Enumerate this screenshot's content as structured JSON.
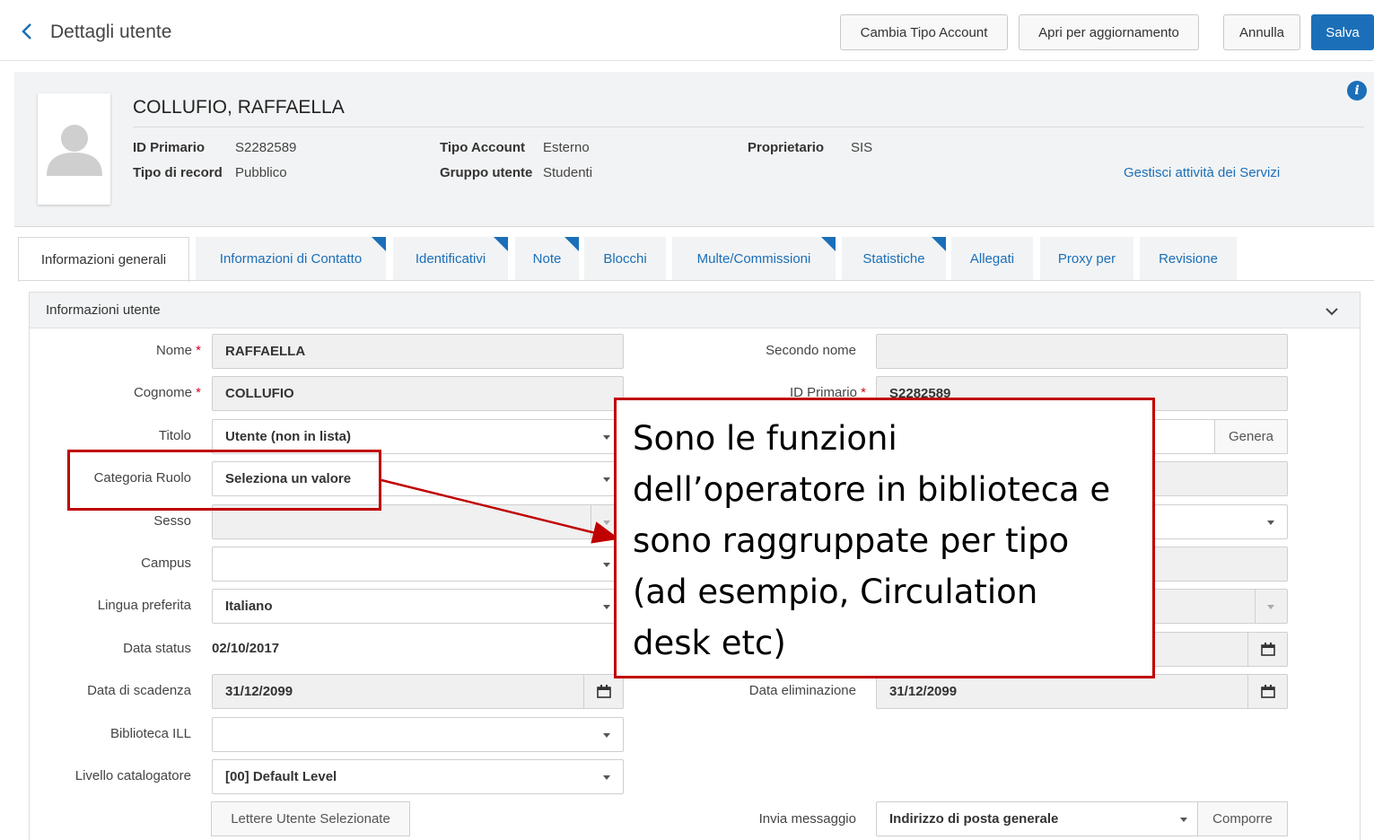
{
  "header": {
    "title": "Dettagli utente",
    "buttons": {
      "change_account_type": "Cambia Tipo Account",
      "open_for_update": "Apri per aggiornamento",
      "cancel": "Annulla",
      "save": "Salva"
    }
  },
  "user": {
    "name": "COLLUFIO, RAFFAELLA",
    "primary_id_label": "ID Primario",
    "primary_id": "S2282589",
    "record_type_label": "Tipo di record",
    "record_type": "Pubblico",
    "account_type_label": "Tipo Account",
    "account_type": "Esterno",
    "user_group_label": "Gruppo utente",
    "user_group": "Studenti",
    "owner_label": "Proprietario",
    "owner": "SIS",
    "manage_services_link": "Gestisci attività dei Servizi"
  },
  "tabs": [
    {
      "label": "Informazioni generali",
      "active": true,
      "marked": false
    },
    {
      "label": "Informazioni di Contatto",
      "active": false,
      "marked": true
    },
    {
      "label": "Identificativi",
      "active": false,
      "marked": true
    },
    {
      "label": "Note",
      "active": false,
      "marked": true
    },
    {
      "label": "Blocchi",
      "active": false,
      "marked": false
    },
    {
      "label": "Multe/Commissioni",
      "active": false,
      "marked": true
    },
    {
      "label": "Statistiche",
      "active": false,
      "marked": true
    },
    {
      "label": "Allegati",
      "active": false,
      "marked": false
    },
    {
      "label": "Proxy per",
      "active": false,
      "marked": false
    },
    {
      "label": "Revisione",
      "active": false,
      "marked": false
    }
  ],
  "section": {
    "title": "Informazioni utente",
    "required_mark": "*",
    "left": {
      "first_name": {
        "label": "Nome",
        "value": "RAFFAELLA"
      },
      "last_name": {
        "label": "Cognome",
        "value": "COLLUFIO"
      },
      "title": {
        "label": "Titolo",
        "value": "Utente (non in lista)"
      },
      "role_category": {
        "label": "Categoria Ruolo",
        "value": "Seleziona un valore"
      },
      "gender": {
        "label": "Sesso",
        "value": ""
      },
      "campus": {
        "label": "Campus",
        "value": ""
      },
      "preferred_language": {
        "label": "Lingua preferita",
        "value": "Italiano"
      },
      "status_date": {
        "label": "Data status",
        "value": "02/10/2017"
      },
      "expiry_date": {
        "label": "Data di scadenza",
        "value": "31/12/2099"
      },
      "ill_library": {
        "label": "Biblioteca ILL",
        "value": ""
      },
      "cataloger_level": {
        "label": "Livello catalogatore",
        "value": "[00] Default Level"
      },
      "letters_button": "Lettere Utente Selezionate"
    },
    "right": {
      "middle_name": {
        "label": "Secondo nome",
        "value": ""
      },
      "primary_id": {
        "label": "ID Primario",
        "value": "S2282589"
      },
      "generate_button": "Genera",
      "purge_date": {
        "label": "Data eliminazione",
        "value": "31/12/2099"
      },
      "send_message": {
        "label": "Invia messaggio",
        "value": "Indirizzo di posta generale"
      },
      "compose_button": "Comporre"
    }
  },
  "annotation": {
    "lines": [
      "Sono le funzioni",
      "dell’operatore in biblioteca e",
      "sono raggruppate per tipo",
      "(ad esempio, Circulation",
      "desk etc)"
    ],
    "color": "#c00000"
  },
  "colors": {
    "accent": "#1b6fb8",
    "required": "#d0021b",
    "panel_bg": "#f2f3f4"
  }
}
